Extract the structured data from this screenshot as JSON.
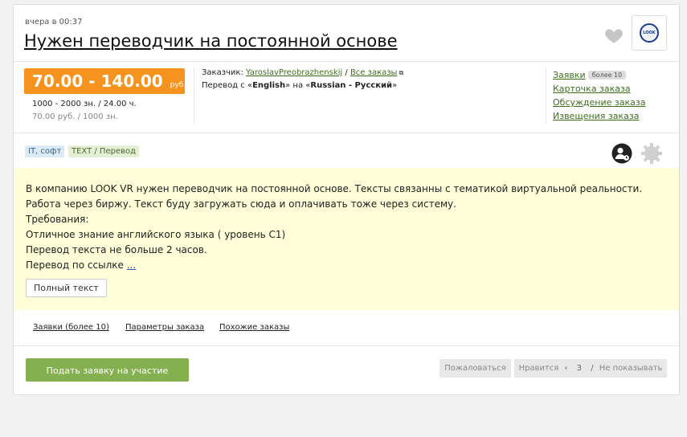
{
  "order": {
    "timestamp": "вчера в 00:37",
    "title": "Нужен переводчик на постоянной основе",
    "logo_text": "LOOK"
  },
  "price": {
    "range": "70.00 - 140.00",
    "currency": "руб.",
    "volume": "1000 - 2000 зн.  /  24.00 ч.",
    "rate": "70.00 руб. / 1000 зн."
  },
  "customer": {
    "label": "Заказчик:",
    "name": "YaroslavPreobrazhenskij",
    "separator": "/",
    "all_orders": "Все заказы",
    "translation_prefix": "Перевод с «",
    "source_lang": "English",
    "translation_mid": "» на «",
    "target_lang": "Russian - Русский",
    "translation_suffix": "»"
  },
  "side_links": {
    "applications": "Заявки",
    "applications_badge": "более 10",
    "card": "Карточка заказа",
    "discussion": "Обсуждение заказа",
    "notices": "Извещения заказа"
  },
  "tags": [
    "IT, софт",
    "TEXT / Перевод"
  ],
  "description": {
    "lines": [
      "В компанию LOOK VR нужен переводчик на постоянной основе. Тексты связанны с тематикой виртуальной реальности. Работа через биржу. Текст буду загружать сюда и оплачивать тоже через систему.",
      "Требования:",
      "Отличное знание английского языка ( уровень C1)",
      "Перевод текста не больше 2 часов."
    ],
    "last_line": "Перевод по ссылке",
    "more": "...",
    "full_text_button": "Полный текст"
  },
  "sub_tabs": {
    "applications": "Заявки (более 10)",
    "params": "Параметры заказа",
    "similar": "Похожие заказы"
  },
  "actions": {
    "apply": "Подать заявку на участие",
    "report": "Пожаловаться",
    "like": "Нравится",
    "like_arrow": "‹",
    "like_count": "3",
    "hide_sep": "/",
    "hide": "Не показывать"
  },
  "colors": {
    "price_orange": "#f6931e",
    "link_green": "#3d6e1e",
    "apply_green": "#85b04f",
    "description_bg": "#fefed8"
  }
}
